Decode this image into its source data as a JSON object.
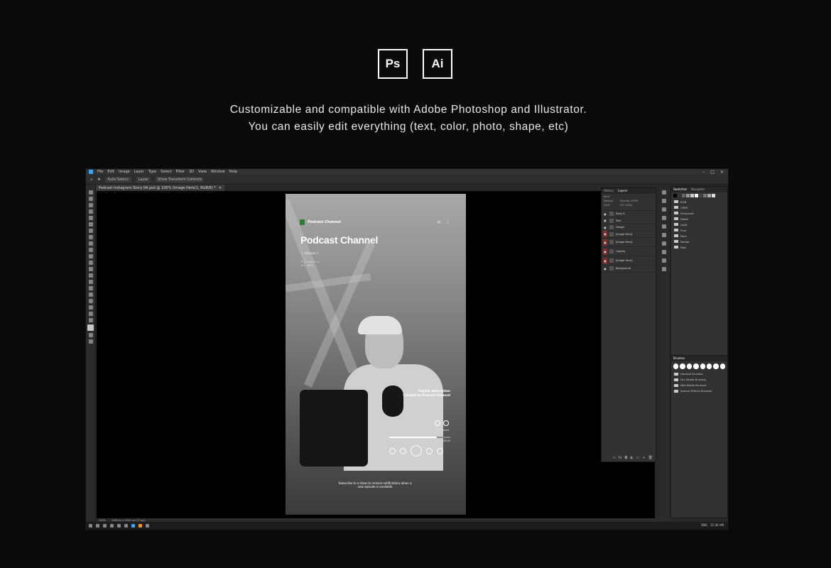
{
  "hero": {
    "badges": [
      "Ps",
      "Ai"
    ],
    "line1": "Customizable and compatible with Adobe Photoshop and Illustrator.",
    "line2": "You can easily edit everything (text, color, photo, shape, etc)"
  },
  "photoshop": {
    "menu": [
      "File",
      "Edit",
      "Image",
      "Layer",
      "Type",
      "Select",
      "Filter",
      "3D",
      "View",
      "Window",
      "Help"
    ],
    "options": {
      "auto_select": "Auto-Select:",
      "layer": "Layer",
      "transform": "Show Transform Controls"
    },
    "doc_tab": "Podcast Instagram Story 04.psd @ 100% (Image Here(1, RGB/8) *",
    "status": {
      "zoom": "100%",
      "doc": "1080 px x 1920 px (72 ppi)"
    },
    "taskbar_tray": {
      "lang": "ENG",
      "time": "12:36 AM"
    }
  },
  "artboard": {
    "brand": "Podcast Channel",
    "title": "Podcast Channel",
    "episode": "Episode 1",
    "followers_label": "Followers",
    "followers_value": "42.85k",
    "desc_line1": "Playlist description",
    "desc_line2": "Created by Podcast Channel",
    "downloaded": "Downloaded",
    "progress": 0.78,
    "time": "08:00",
    "subscribe_line1": "Subscribe to a show to receive notifications when a",
    "subscribe_line2": "new episode is available"
  },
  "layers_panel": {
    "tabs": [
      "History",
      "Layers"
    ],
    "kind": "Kind",
    "blend": "Normal",
    "opacity": "Opacity: 100%",
    "fill": "Fill: 100%",
    "lock": "Lock:",
    "rows": [
      "Story 4",
      "Text",
      "Design",
      "[Image Here]",
      "[Image Here]",
      "Opacity",
      "[Image Here]",
      "Background"
    ]
  },
  "swatches_panel": {
    "tabs": [
      "Swatches",
      "Navigator"
    ],
    "colors": [
      "#000000",
      "#333333",
      "#666666",
      "#999999",
      "#cccccc",
      "#ffffff",
      "#444444",
      "#777777",
      "#aaaaaa",
      "#dddddd"
    ],
    "folders": [
      "RGB",
      "CMYK",
      "Grayscale",
      "Pastel",
      "Light",
      "Pure",
      "Dark",
      "Darker",
      "Pale"
    ]
  },
  "brushes_panel": {
    "title": "Brushes",
    "folders": [
      "General Brushes",
      "Dry Media Brushes",
      "Wet Media Brushes",
      "Special Effects Brushes"
    ]
  }
}
